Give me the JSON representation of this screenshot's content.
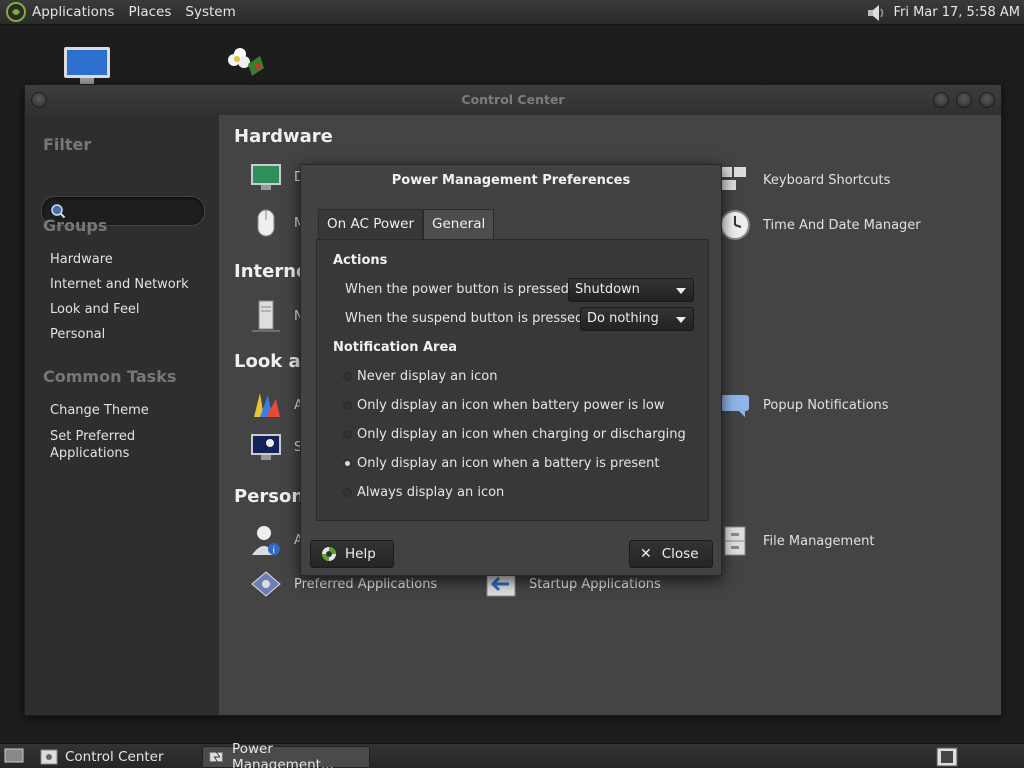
{
  "top_panel": {
    "menus": [
      "Applications",
      "Places",
      "System"
    ],
    "clock": "Fri Mar 17,  5:58 AM"
  },
  "control_center": {
    "title": "Control Center",
    "sidebar": {
      "filter_heading": "Filter",
      "search_placeholder": "",
      "groups_heading": "Groups",
      "groups": [
        "Hardware",
        "Internet and Network",
        "Look and Feel",
        "Personal"
      ],
      "tasks_heading": "Common Tasks",
      "tasks": [
        "Change Theme",
        "Set Preferred\nApplications"
      ]
    },
    "main": {
      "sections": [
        "Hardware",
        "Internet",
        "Look an",
        "Persona"
      ],
      "items": {
        "hw_display": "D",
        "hw_mouse": "M",
        "keyboard_shortcuts": "Keyboard Shortcuts",
        "time_date": "Time And Date Manager",
        "net_proxy": "N",
        "look_appearance": "A",
        "look_screensaver": "S",
        "popup_notifications": "Popup Notifications",
        "personal_about": "A",
        "file_management": "File Management",
        "preferred_apps": "Preferred Applications",
        "startup_apps": "Startup Applications"
      }
    }
  },
  "dialog": {
    "title": "Power Management Preferences",
    "tabs": [
      "On AC Power",
      "General"
    ],
    "active_tab": "General",
    "actions_heading": "Actions",
    "power_button_label": "When the power button is pressed:",
    "power_button_value": "Shutdown",
    "suspend_button_label": "When the suspend button is pressed:",
    "suspend_button_value": "Do nothing",
    "notification_heading": "Notification Area",
    "radio_options": [
      "Never display an icon",
      "Only display an icon when battery power is low",
      "Only display an icon when charging or discharging",
      "Only display an icon when a battery is present",
      "Always display an icon"
    ],
    "selected_option": "Only display an icon when a battery is present",
    "help_label": "Help",
    "close_label": "Close"
  },
  "taskbar": {
    "items": [
      "Control Center",
      "Power Management..."
    ]
  }
}
